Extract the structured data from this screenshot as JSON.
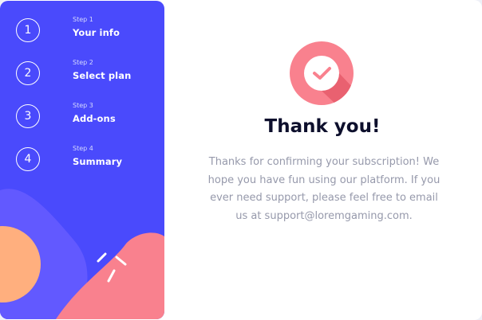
{
  "steps": [
    {
      "number": "1",
      "caption": "Step 1",
      "name": "Your info"
    },
    {
      "number": "2",
      "caption": "Step 2",
      "name": "Select plan"
    },
    {
      "number": "3",
      "caption": "Step 3",
      "name": "Add-ons"
    },
    {
      "number": "4",
      "caption": "Step 4",
      "name": "Summary"
    }
  ],
  "confirmation": {
    "icon": "checkmark-icon",
    "title": "Thank you!",
    "message": "Thanks for confirming your subscription! We hope you have fun using our platform. If you ever need support, please feel free to email us at support@loremgaming.com."
  },
  "colors": {
    "sidebar": "#4a4afc",
    "accent_pink": "#f9818e",
    "accent_orange": "#ffaf7e",
    "title": "#0d0f2c",
    "body_text": "#9699ab"
  }
}
